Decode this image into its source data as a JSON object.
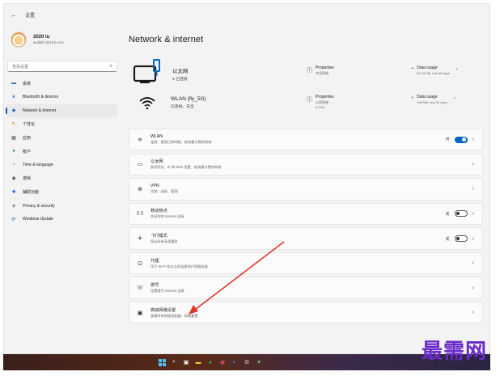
{
  "window": {
    "title": "设置",
    "back_icon": "back-arrow-icon"
  },
  "account": {
    "name": "2020 lu",
    "email": "wulibili7@163.com"
  },
  "search": {
    "placeholder": "查找设置"
  },
  "nav": [
    {
      "icon": "system-icon",
      "glyph": "▬",
      "color": "#2b6cb0",
      "label": "系统"
    },
    {
      "icon": "bluetooth-icon",
      "glyph": "ʙ",
      "color": "#0067c0",
      "label": "Bluetooth & devices"
    },
    {
      "icon": "network-icon",
      "glyph": "◆",
      "color": "#2b6cb0",
      "label": "Network & internet",
      "active": true
    },
    {
      "icon": "personalization-icon",
      "glyph": "✎",
      "color": "#d97706",
      "label": "个性化"
    },
    {
      "icon": "apps-icon",
      "glyph": "▦",
      "color": "#555555",
      "label": "应用"
    },
    {
      "icon": "accounts-icon",
      "glyph": "●",
      "color": "#2f855a",
      "label": "帐户"
    },
    {
      "icon": "time-language-icon",
      "glyph": "◔",
      "color": "#2b6cb0",
      "label": "Time & language"
    },
    {
      "icon": "gaming-icon",
      "glyph": "◉",
      "color": "#555555",
      "label": "游戏"
    },
    {
      "icon": "accessibility-icon",
      "glyph": "✚",
      "color": "#1a56db",
      "label": "辅助功能"
    },
    {
      "icon": "privacy-icon",
      "glyph": "◈",
      "color": "#777777",
      "label": "Privacy & security"
    },
    {
      "icon": "windows-update-icon",
      "glyph": "⟳",
      "color": "#0067c0",
      "label": "Windows Update"
    }
  ],
  "main": {
    "title": "Network & internet"
  },
  "ethernet": {
    "name": "以太网",
    "status": "已连接",
    "properties": {
      "title": "Properties",
      "subtitle": "专用网络"
    },
    "usage": {
      "title": "Data usage",
      "subtitle": "54.43 GB, last 30 days"
    }
  },
  "wifi": {
    "name": "WLAN (fly_5G)",
    "status": "已连接，安全",
    "properties": {
      "title": "Properties",
      "subtitle": "公用网络",
      "extra": "5 GHz"
    },
    "usage": {
      "title": "Data usage",
      "subtitle": "446 MB, last 30 days"
    }
  },
  "cards": [
    {
      "icon": "wifi-icon",
      "glyph": "≋",
      "title": "WLAN",
      "desc": "连接、管理已知网络、按流量计费的网络",
      "state": "开",
      "toggle": "on"
    },
    {
      "icon": "ethernet-icon",
      "glyph": "▭",
      "title": "以太网",
      "desc": "身份验证、IP 和 DNS 设置、按流量计费的网络",
      "state": "",
      "toggle": ""
    },
    {
      "icon": "vpn-icon",
      "glyph": "⊕",
      "title": "VPN",
      "desc": "添加、连接、管理",
      "state": "",
      "toggle": ""
    },
    {
      "icon": "mobile-hotspot-icon",
      "glyph": "((·))",
      "title": "移动热点",
      "desc": "共享你的 Internet 连接",
      "state": "关",
      "toggle": "off"
    },
    {
      "icon": "airplane-mode-icon",
      "glyph": "✈",
      "title": "飞行模式",
      "desc": "停止所有无线通信",
      "state": "关",
      "toggle": "off"
    },
    {
      "icon": "proxy-icon",
      "glyph": "⊡",
      "title": "代理",
      "desc": "用于 Wi-Fi 和以太网连接的代理服务器",
      "state": "",
      "toggle": ""
    },
    {
      "icon": "dial-up-icon",
      "glyph": "☏",
      "title": "拨号",
      "desc": "设置拨号 Internet 连接",
      "state": "",
      "toggle": ""
    },
    {
      "icon": "advanced-network-icon",
      "glyph": "▣",
      "title": "高级网络设置",
      "desc": "查看所有网络适配器，网络重置",
      "state": "",
      "toggle": ""
    }
  ],
  "taskbar": [
    "start-icon",
    "search-icon",
    "task-view-icon",
    "file-explorer-icon",
    "chrome-icon",
    "app-icon",
    "browser-icon",
    "settings-icon",
    "feather-icon"
  ],
  "watermark": "最需网",
  "colors": {
    "accent": "#0067c0",
    "arrow": "#e0362c",
    "watermark": "#6a2bc8"
  }
}
